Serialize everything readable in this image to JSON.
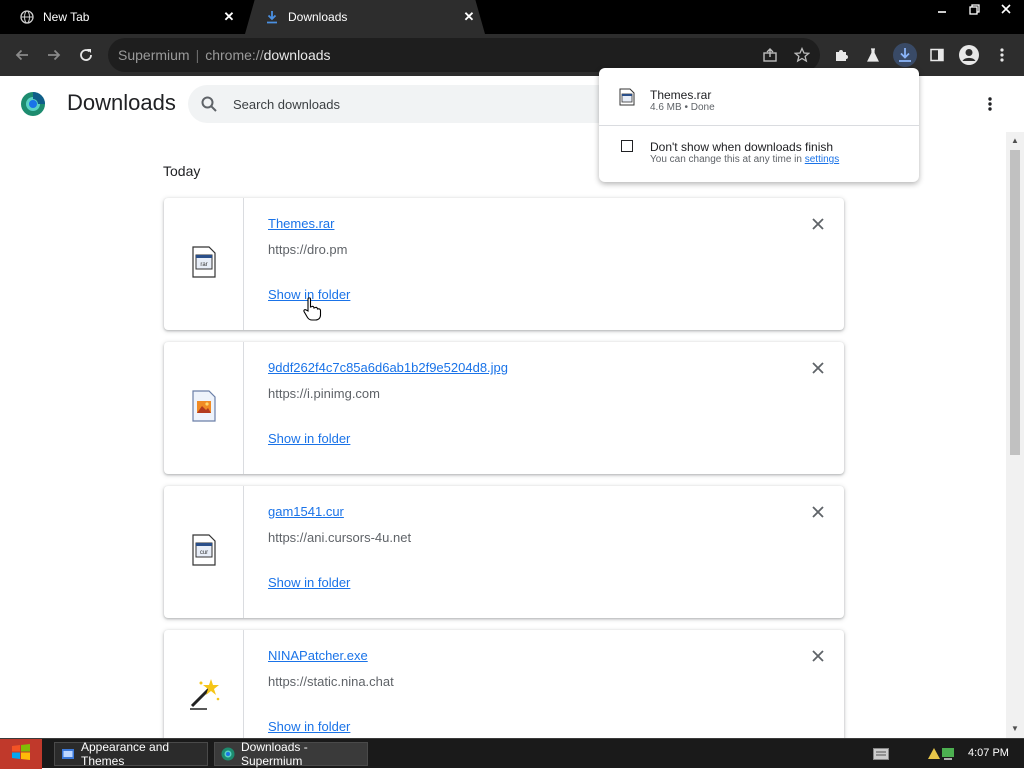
{
  "browser": {
    "tabs": [
      {
        "title": "New Tab",
        "active": false
      },
      {
        "title": "Downloads",
        "active": true
      }
    ],
    "omnibox": {
      "brand": "Supermium",
      "scheme": "chrome://",
      "host": "downloads"
    }
  },
  "app": {
    "title": "Downloads",
    "search_placeholder": "Search downloads"
  },
  "main": {
    "day_header": "Today",
    "items": [
      {
        "filename": "Themes.rar",
        "url": "https://dro.pm",
        "action": "Show in folder",
        "icon": "archive-file-icon"
      },
      {
        "filename": "9ddf262f4c7c85a6d6ab1b2f9e5204d8.jpg",
        "url": "https://i.pinimg.com",
        "action": "Show in folder",
        "icon": "image-file-icon"
      },
      {
        "filename": "gam1541.cur",
        "url": "https://ani.cursors-4u.net",
        "action": "Show in folder",
        "icon": "cursor-file-icon"
      },
      {
        "filename": "NINAPatcher.exe",
        "url": "https://static.nina.chat",
        "action": "Show in folder",
        "icon": "wand-icon"
      }
    ]
  },
  "bubble": {
    "filename": "Themes.rar",
    "status": "4.6 MB • Done",
    "checkbox_label": "Don't show when downloads finish",
    "hint_text": "You can change this at any time in",
    "hint_link": "settings"
  },
  "taskbar": {
    "tasks": [
      {
        "label": "Appearance and Themes"
      },
      {
        "label": "Downloads - Supermium"
      }
    ],
    "clock": "4:07 PM"
  },
  "colors": {
    "accent": "#1a73e8",
    "tab_active": "#2d2d2d",
    "toolbar": "#2d2d2d"
  }
}
